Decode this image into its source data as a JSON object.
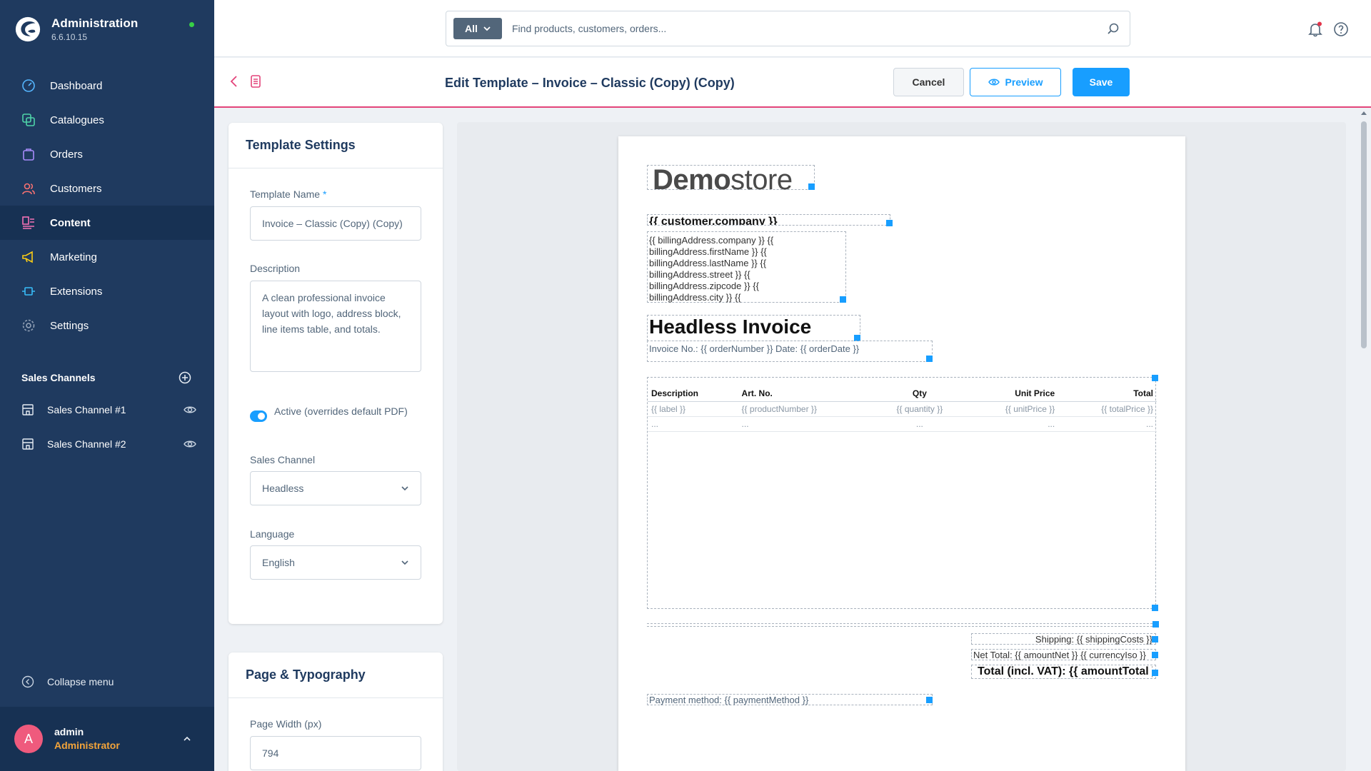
{
  "app": {
    "title": "Administration",
    "version": "6.6.10.15"
  },
  "nav": [
    {
      "label": "Dashboard",
      "icon": "dashboard-icon"
    },
    {
      "label": "Catalogues",
      "icon": "catalogue-icon"
    },
    {
      "label": "Orders",
      "icon": "orders-icon"
    },
    {
      "label": "Customers",
      "icon": "customers-icon"
    },
    {
      "label": "Content",
      "icon": "content-icon",
      "active": true
    },
    {
      "label": "Marketing",
      "icon": "megaphone-icon"
    },
    {
      "label": "Extensions",
      "icon": "extensions-icon"
    },
    {
      "label": "Settings",
      "icon": "gear-icon"
    }
  ],
  "sales_channels": {
    "title": "Sales Channels",
    "items": [
      {
        "label": "Sales Channel #1"
      },
      {
        "label": "Sales Channel #2"
      }
    ]
  },
  "sidebar_footer": {
    "collapse_label": "Collapse menu",
    "user_initial": "A",
    "user_name": "admin",
    "user_role": "Administrator"
  },
  "search": {
    "scope_label": "All",
    "placeholder": "Find products, customers, orders..."
  },
  "smartbar": {
    "title": "Edit Template – Invoice – Classic (Copy) (Copy)",
    "cancel_label": "Cancel",
    "preview_label": "Preview",
    "save_label": "Save"
  },
  "template_settings": {
    "heading": "Template Settings",
    "name_label": "Template Name",
    "name_required": "*",
    "name_value": "Invoice – Classic (Copy) (Copy)",
    "description_label": "Description",
    "description_value": "A clean professional invoice layout with logo, address block, line items table, and totals.",
    "active_label": "Active (overrides default PDF)",
    "active_value": true,
    "sales_channel_label": "Sales Channel",
    "sales_channel_value": "Headless",
    "language_label": "Language",
    "language_value": "English"
  },
  "page_typography": {
    "heading": "Page & Typography",
    "page_width_label": "Page Width (px)",
    "page_width_value": "794"
  },
  "document": {
    "logo_bold": "Demo",
    "logo_light": "store",
    "customer_company": "{{ customer.company }}",
    "address_lines": [
      "{{ billingAddress.company }} {{",
      "billingAddress.firstName }} {{",
      "billingAddress.lastName }} {{",
      "billingAddress.street }} {{",
      "billingAddress.zipcode }} {{",
      "billingAddress.city }} {{"
    ],
    "invoice_title": "Headless Invoice",
    "invoice_meta": "Invoice No.: {{ orderNumber }} Date: {{ orderDate }}",
    "table_headers": [
      "Description",
      "Art. No.",
      "Qty",
      "Unit Price",
      "Total"
    ],
    "table_row": [
      "{{ label }}",
      "{{ productNumber }}",
      "{{ quantity }}",
      "{{ unitPrice }}",
      "{{ totalPrice }}"
    ],
    "table_ellipsis": [
      "...",
      "...",
      "...",
      "...",
      "..."
    ],
    "shipping": "Shipping: {{ shippingCosts }}",
    "net_total": "Net Total: {{ amountNet }} {{ currencyIso }}",
    "grand_total": "Total (incl. VAT): {{ amountTotal }}",
    "payment": "Payment method: {{ paymentMethod }}"
  },
  "colors": {
    "sidebar": "#1f3a5f",
    "accent": "#189eff",
    "smartbar_border": "#e3447a",
    "avatar": "#ef5a7d",
    "role": "#f3a43a"
  }
}
